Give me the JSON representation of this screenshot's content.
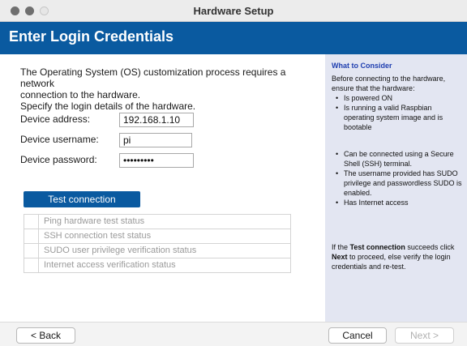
{
  "window": {
    "title": "Hardware Setup"
  },
  "header": {
    "title": "Enter Login Credentials"
  },
  "intro": {
    "line1": "The Operating System (OS) customization process requires a network",
    "line2": "connection to the hardware.",
    "line3": "Specify the login details of the hardware."
  },
  "form": {
    "address_label": "Device address:",
    "address_value": "192.168.1.10",
    "username_label": "Device username:",
    "username_value": "pi",
    "password_label": "Device password:",
    "password_value": "•••••••••"
  },
  "test_button": "Test connection",
  "status": [
    "Ping hardware test status",
    "SSH connection test status",
    "SUDO user privilege verification status",
    "Internet access verification status"
  ],
  "side": {
    "heading": "What to Consider",
    "intro1": "Before connecting to the hardware,",
    "intro2": "ensure that the hardware:",
    "items": [
      [
        "Is powered ON"
      ],
      [
        "Is running a valid Raspbian",
        "operating system image and is",
        "bootable"
      ],
      [
        "Can be connected using a Secure",
        "Shell (SSH) terminal."
      ],
      [
        "The username provided has SUDO",
        "privilege and passwordless SUDO is",
        "enabled."
      ],
      [
        "Has Internet access"
      ]
    ],
    "footer_prefix": "If the ",
    "footer_bold1": "Test connection",
    "footer_mid": " succeeds click",
    "footer_bold2": "Next",
    "footer_rest1": " to proceed, else verify the login",
    "footer_rest2": "credentials and re-test."
  },
  "buttons": {
    "back": "< Back",
    "cancel": "Cancel",
    "next": "Next >"
  },
  "colors": {
    "accent": "#0a5aa0",
    "side_bg": "#e3e6f2",
    "side_heading": "#1f3fb0"
  },
  "icons": {
    "close": "traffic-light-close",
    "minimize": "traffic-light-minimize",
    "zoom": "traffic-light-zoom"
  }
}
